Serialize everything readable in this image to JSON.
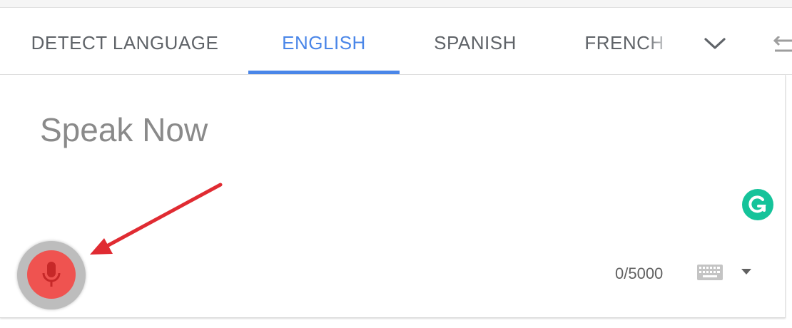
{
  "tabs": [
    {
      "label": "DETECT LANGUAGE"
    },
    {
      "label": "ENGLISH",
      "active": true
    },
    {
      "label": "SPANISH"
    },
    {
      "label": "FRENCH"
    }
  ],
  "icons": {
    "more_languages": "chevron-down-icon",
    "swap": "swap-languages-icon",
    "grammarly": "grammarly-icon",
    "microphone": "microphone-icon",
    "keyboard": "keyboard-icon",
    "keyboard_menu": "caret-down-icon",
    "annotation": "red-arrow-annotation"
  },
  "input": {
    "placeholder": "Speak Now",
    "char_count": "0/5000"
  },
  "colors": {
    "accent": "#4a86e8",
    "mic_active": "#ef5350",
    "grammarly": "#15c39a",
    "annotation_arrow": "#e02b32"
  }
}
